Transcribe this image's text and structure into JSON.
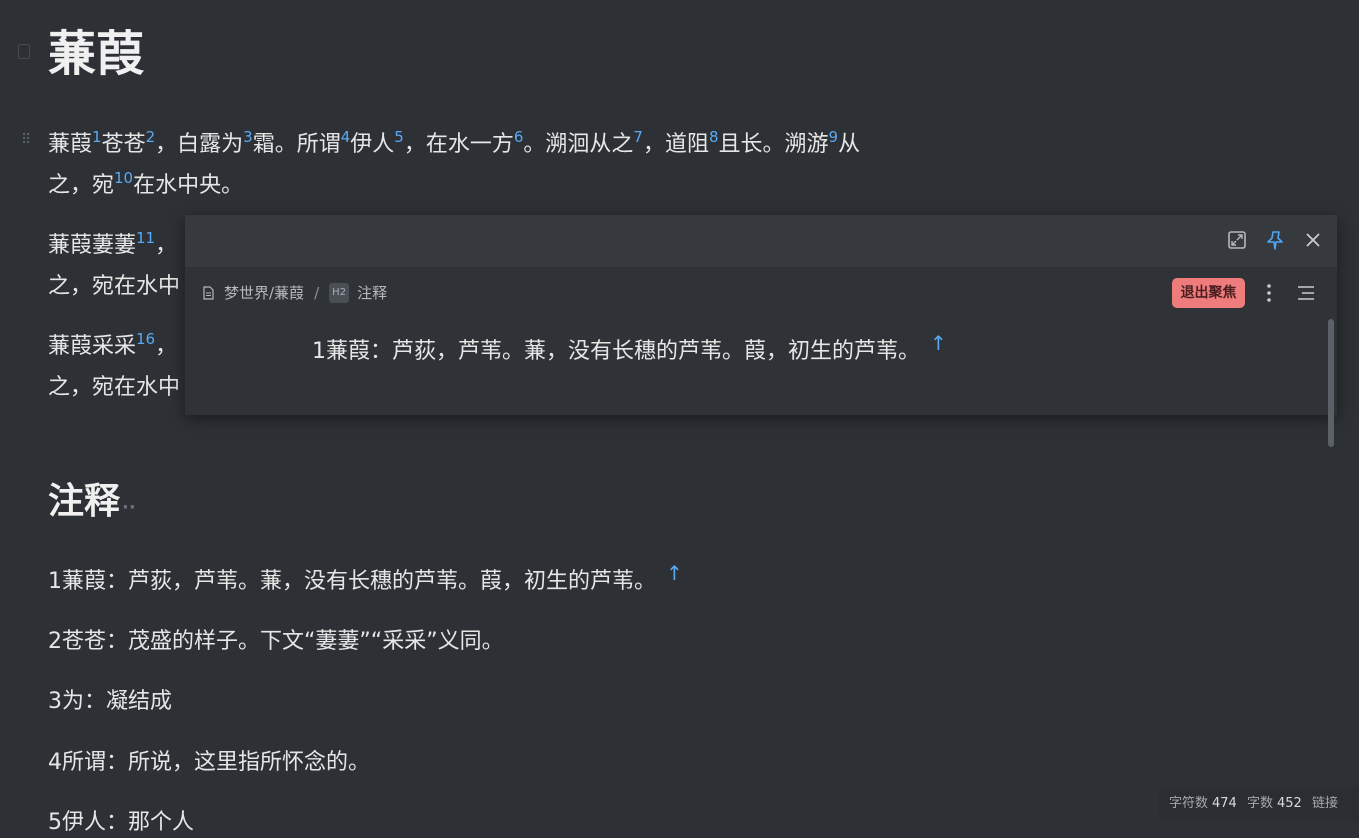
{
  "document": {
    "title": "蒹葭",
    "paragraphs": [
      {
        "lines": [
          [
            [
              "蒹葭",
              "1"
            ],
            [
              "苍苍",
              "2"
            ],
            [
              "，白露为",
              "3"
            ],
            [
              "霜。所谓",
              "4"
            ],
            [
              "伊人",
              "5"
            ],
            [
              "，在水一方",
              "6"
            ],
            [
              "。溯洄从之",
              "7"
            ],
            [
              "，道阻",
              "8"
            ],
            [
              "且长。溯游",
              "9"
            ],
            [
              "从",
              ""
            ]
          ],
          [
            [
              "之，宛",
              "10"
            ],
            [
              "在水中央。",
              ""
            ]
          ]
        ]
      },
      {
        "lines": [
          [
            [
              "蒹葭萋萋",
              "11"
            ],
            [
              "，",
              ""
            ]
          ],
          [
            [
              "之，宛在水中",
              ""
            ]
          ]
        ]
      },
      {
        "lines": [
          [
            [
              "蒹葭采采",
              "16"
            ],
            [
              "，",
              ""
            ]
          ],
          [
            [
              "之，宛在水中",
              ""
            ]
          ]
        ]
      }
    ],
    "notes_heading": "注释",
    "notes_heading_dots": "··",
    "notes": [
      {
        "text": "1蒹葭：芦荻，芦苇。蒹，没有长穗的芦苇。葭，初生的芦苇。",
        "back": "↑"
      },
      {
        "text": "2苍苍：茂盛的样子。下文“萋萋”“采采”义同。",
        "back": ""
      },
      {
        "text": "3为：凝结成",
        "back": ""
      },
      {
        "text": "4所谓：所说，这里指所怀念的。",
        "back": ""
      },
      {
        "text": "5伊人：那个人",
        "back": ""
      }
    ]
  },
  "popup": {
    "breadcrumb_path": "梦世界/蒹葭",
    "breadcrumb_sep": "/",
    "heading_badge": "H2",
    "heading_name": "注释",
    "exit_focus_label": "退出聚焦",
    "content": "1蒹葭：芦荻，芦苇。蒹，没有长穗的芦苇。葭，初生的芦苇。",
    "content_back": "↑",
    "icons": {
      "open": "open-in-tab-icon",
      "pin": "pin-icon",
      "close": "close-icon",
      "more": "more-vertical-icon",
      "outline": "outline-icon"
    }
  },
  "statusbar": {
    "char_label": "字符数",
    "char_count": "474",
    "word_label": "字数",
    "word_count": "452",
    "link_label": "链接"
  },
  "colors": {
    "background": "#2d3135",
    "link": "#5aa9f2",
    "exit_focus": "#ef7c7c"
  }
}
